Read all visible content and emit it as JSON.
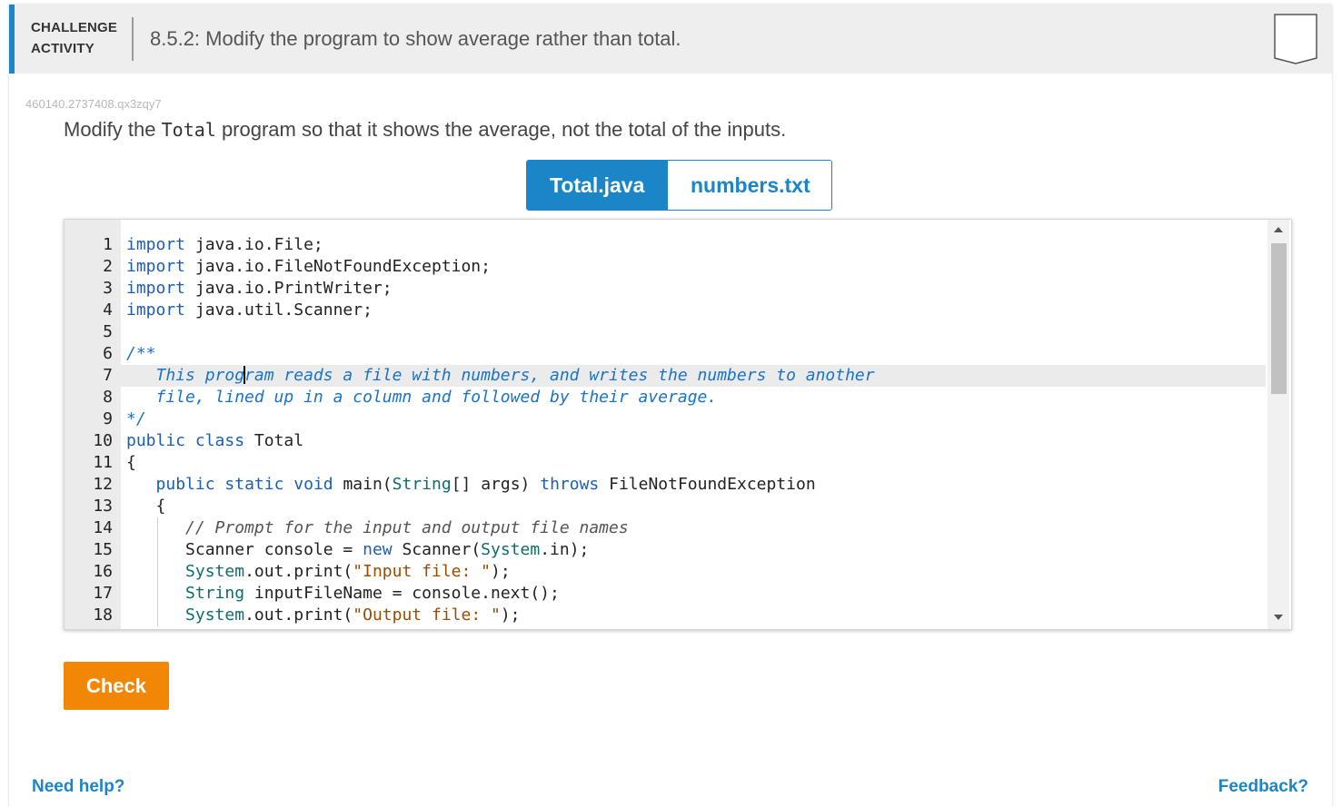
{
  "header": {
    "label_line1": "CHALLENGE",
    "label_line2": "ACTIVITY",
    "title": "8.5.2: Modify the program to show average rather than total."
  },
  "activity_id": "460140.2737408.qx3zqy7",
  "instructions": {
    "before": "Modify the ",
    "code": "Total",
    "after": " program so that it shows the average, not the total of the inputs."
  },
  "tabs": [
    {
      "label": "Total.java",
      "active": true
    },
    {
      "label": "numbers.txt",
      "active": false
    }
  ],
  "editor": {
    "active_line": 7,
    "lines": [
      {
        "n": "1"
      },
      {
        "n": "2"
      },
      {
        "n": "3"
      },
      {
        "n": "4"
      },
      {
        "n": "5"
      },
      {
        "n": "6"
      },
      {
        "n": "7"
      },
      {
        "n": "8"
      },
      {
        "n": "9"
      },
      {
        "n": "10"
      },
      {
        "n": "11"
      },
      {
        "n": "12"
      },
      {
        "n": "13"
      },
      {
        "n": "14"
      },
      {
        "n": "15"
      },
      {
        "n": "16"
      },
      {
        "n": "17"
      },
      {
        "n": "18"
      }
    ],
    "tokens": {
      "import": "import",
      "l1": " java.io.File;",
      "l2": " java.io.FileNotFoundException;",
      "l3": " java.io.PrintWriter;",
      "l4": " java.util.Scanner;",
      "l6": "/**",
      "l7a": "   This prog",
      "l7b": "ram reads a file with numbers, and writes the numbers to another",
      "l8": "   file, lined up in a column and followed by their average.",
      "l9": "*/",
      "public": "public",
      "class": "class",
      "l10": " Total",
      "l11": "{",
      "static": "static",
      "void": "void",
      "main": " main(",
      "String": "String",
      "args": "[] args) ",
      "throws": "throws",
      "fnfe": " FileNotFoundException",
      "l13": "   {",
      "l14": "// Prompt for the input and output file names",
      "l15a": "Scanner console = ",
      "new": "new",
      "l15b": " Scanner(",
      "System": "System",
      "l15c": ".in);",
      "out_print": ".out.print(",
      "l16s": "\"Input file: \"",
      "close": ");",
      "l17a": " inputFileName = console.next();",
      "l18s": "\"Output file: \""
    }
  },
  "check_label": "Check",
  "help_label": "Need help?",
  "feedback_label": "Feedback?"
}
